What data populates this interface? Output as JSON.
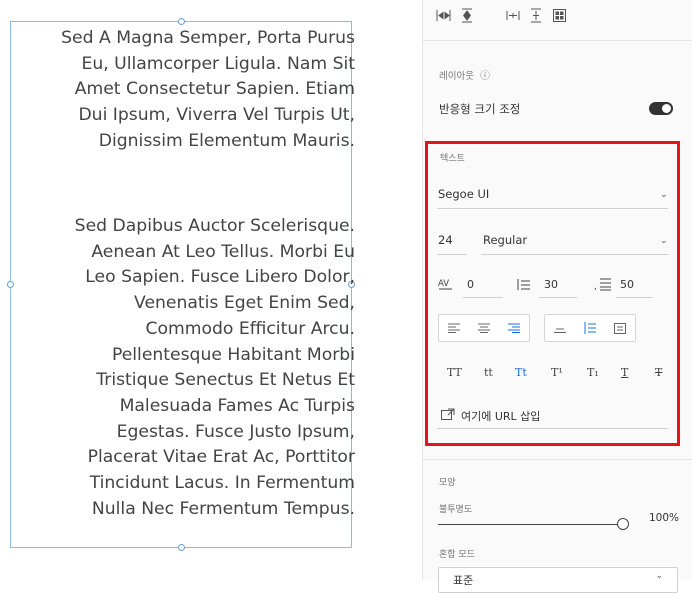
{
  "paragraph1": [
    "Sed A Magna Semper, Porta Purus",
    "Eu, Ullamcorper Ligula. Nam Sit",
    "Amet Consectetur Sapien. Etiam",
    "Dui Ipsum, Viverra Vel Turpis Ut,",
    "Dignissim Elementum Mauris."
  ],
  "paragraph2": [
    "Sed Dapibus Auctor Scelerisque.",
    "Aenean At Leo Tellus. Morbi Eu",
    "Leo Sapien. Fusce Libero Dolor,",
    "Venenatis Eget Enim Sed,",
    "Commodo Efficitur Arcu.",
    "Pellentesque Habitant Morbi",
    "Tristique Senectus Et Netus Et",
    "Malesuada Fames Ac Turpis",
    "Egestas. Fusce Justo Ipsum,",
    "Placerat Vitae Erat Ac, Porttitor",
    "Tincidunt Lacus. In Fermentum",
    "Nulla Nec Fermentum Tempus."
  ],
  "layout_section": {
    "title": "레이아웃",
    "info_icon": "ⓘ",
    "responsive_label": "반응형 크기 조정",
    "responsive_on": true
  },
  "text_section": {
    "title": "텍스트",
    "font_family": "Segoe UI",
    "font_size": "24",
    "font_weight": "Regular",
    "char_spacing": "0",
    "line_spacing": "30",
    "paragraph_spacing": "50",
    "align_active": "right",
    "valign_active": "top",
    "case_buttons": [
      "TT",
      "tt",
      "Tt",
      "T¹",
      "T₁",
      "T",
      "T"
    ],
    "case_active_index": 2,
    "url_label": "여기에 URL 삽입"
  },
  "appearance_section": {
    "title": "모양",
    "opacity_label": "불투명도",
    "opacity_value": "100%",
    "blend_label": "혼합 모드",
    "blend_value": "표준"
  },
  "colors": {
    "highlight": "#e8141c",
    "accent": "#1473e6"
  }
}
